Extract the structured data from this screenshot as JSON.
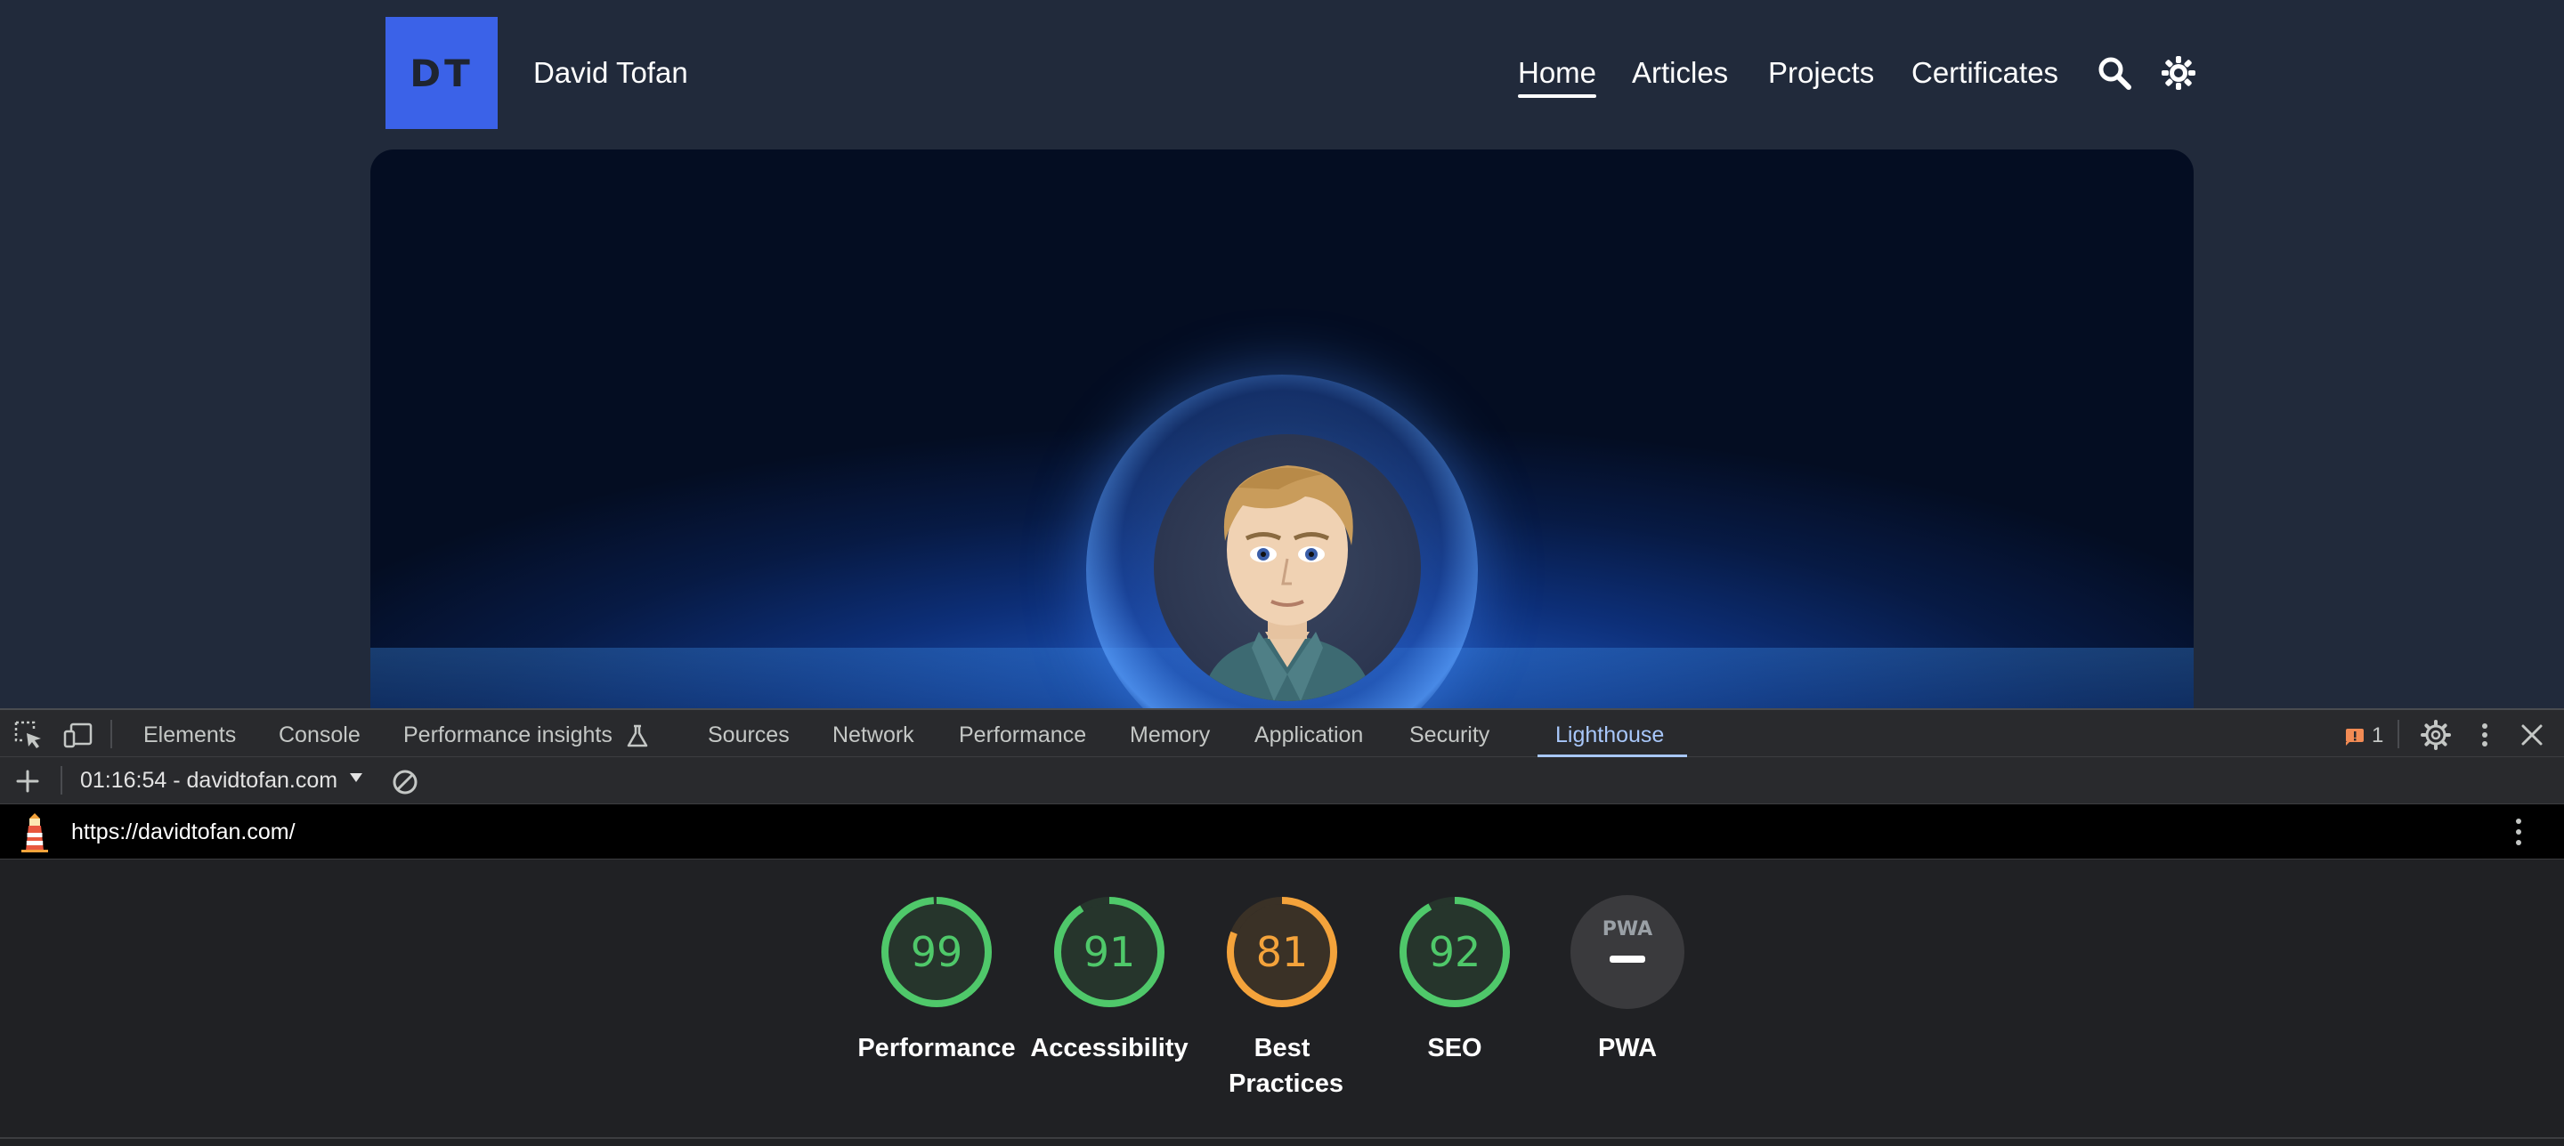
{
  "site": {
    "logo_text": "DT",
    "name": "David Tofan",
    "nav": [
      {
        "label": "Home",
        "active": true
      },
      {
        "label": "Articles",
        "active": false
      },
      {
        "label": "Projects",
        "active": false
      },
      {
        "label": "Certificates",
        "active": false
      }
    ],
    "icons": [
      "search-icon",
      "theme-toggle-icon"
    ],
    "colors": {
      "background": "#212a3b",
      "logo_bg": "#3b62e8"
    }
  },
  "devtools": {
    "tabs": [
      "Elements",
      "Console",
      "Performance insights",
      "Sources",
      "Network",
      "Performance",
      "Memory",
      "Application",
      "Security",
      "Lighthouse"
    ],
    "active_tab": "Lighthouse",
    "issues_count": "1",
    "report_selector": "01:16:54 - davidtofan.com",
    "url": "https://davidtofan.com/",
    "scores": [
      {
        "label": "Performance",
        "value": "99",
        "percent": 99,
        "color": "#4fc86a"
      },
      {
        "label": "Accessibility",
        "value": "91",
        "percent": 91,
        "color": "#4fc86a"
      },
      {
        "label": "Best Practices",
        "value": "81",
        "percent": 81,
        "color": "#f4a33b"
      },
      {
        "label": "SEO",
        "value": "92",
        "percent": 92,
        "color": "#4fc86a"
      },
      {
        "label": "PWA",
        "value": "",
        "badge": "PWA",
        "color": "#3a3a3d"
      }
    ]
  }
}
